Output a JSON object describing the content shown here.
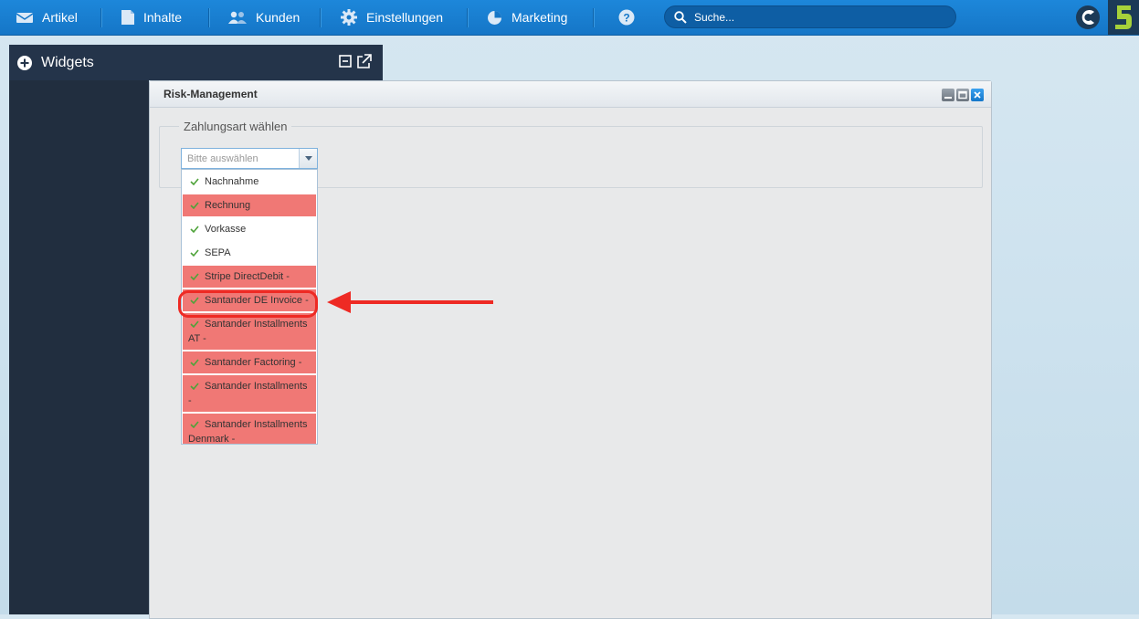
{
  "nav": {
    "items": [
      {
        "label": "Artikel",
        "icon": "article-icon"
      },
      {
        "label": "Inhalte",
        "icon": "content-icon"
      },
      {
        "label": "Kunden",
        "icon": "customers-icon"
      },
      {
        "label": "Einstellungen",
        "icon": "gear-icon"
      },
      {
        "label": "Marketing",
        "icon": "pie-chart-icon"
      }
    ],
    "help_icon": "help-icon",
    "search_placeholder": "Suche..."
  },
  "widgets": {
    "title": "Widgets"
  },
  "window": {
    "title": "Risk-Management",
    "fieldset_legend": "Zahlungsart wählen",
    "combo_placeholder": "Bitte auswählen",
    "options": [
      {
        "label": "Nachnahme",
        "highlighted": false
      },
      {
        "label": "Rechnung",
        "highlighted": true
      },
      {
        "label": "Vorkasse",
        "highlighted": false
      },
      {
        "label": "SEPA",
        "highlighted": false
      },
      {
        "label": "Stripe DirectDebit -",
        "highlighted": true
      },
      {
        "label": "Santander DE Invoice -",
        "highlighted": true
      },
      {
        "label": "Santander Installments AT -",
        "highlighted": true
      },
      {
        "label": "Santander Factoring -",
        "highlighted": true
      },
      {
        "label": "Santander Installments -",
        "highlighted": true
      },
      {
        "label": "Santander Installments Denmark -",
        "highlighted": true
      }
    ]
  },
  "colors": {
    "topbar": "#1d87da",
    "highlight_row": "#f07875",
    "annotation": "#ee2a24",
    "sidebar": "#212e3f"
  }
}
